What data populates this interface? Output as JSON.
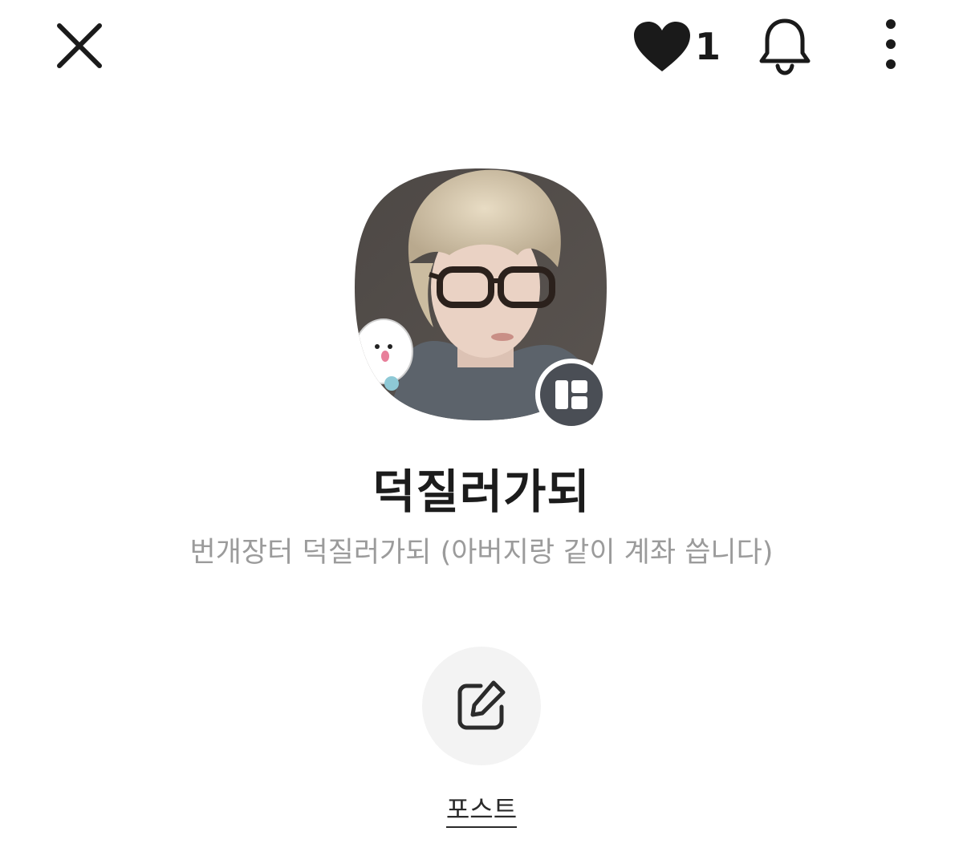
{
  "header": {
    "close_icon": "close-icon",
    "like_icon": "heart-icon",
    "like_count": "1",
    "notification_icon": "bell-icon",
    "more_icon": "more-vertical-icon"
  },
  "profile": {
    "name": "덕질러가되",
    "description": "번개장터 덕질러가되 (아버지랑 같이 계좌 씁니다)",
    "badge_icon": "layout-icon"
  },
  "actions": {
    "post_icon": "edit-icon",
    "post_label": "포스트"
  },
  "colors": {
    "text_primary": "#1c1c1c",
    "text_secondary": "#9b9b9b",
    "action_bg": "#f3f3f3",
    "badge_bg": "#4a4e55"
  }
}
